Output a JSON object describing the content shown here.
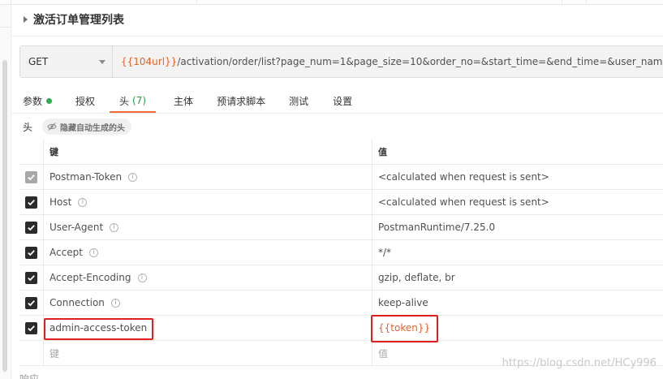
{
  "request": {
    "title": "激活订单管理列表"
  },
  "url_bar": {
    "method": "GET",
    "url_var": "{{104url}}",
    "url_rest": "/activation/order/list?page_num=1&page_size=10&order_no=&start_time=&end_time=&user_name=&order_st"
  },
  "tabs": [
    {
      "label": "参数"
    },
    {
      "label": "授权"
    },
    {
      "label": "头",
      "count": "(7)"
    },
    {
      "label": "主体"
    },
    {
      "label": "预请求脚本"
    },
    {
      "label": "测试"
    },
    {
      "label": "设置"
    }
  ],
  "headers_section": {
    "label": "头",
    "hide_button": "隐藏自动生成的头"
  },
  "table": {
    "col_key": "键",
    "col_value": "值",
    "rows": [
      {
        "key": "Postman-Token",
        "value": "<calculated when request is sent>"
      },
      {
        "key": "Host",
        "value": "<calculated when request is sent>"
      },
      {
        "key": "User-Agent",
        "value": "PostmanRuntime/7.25.0"
      },
      {
        "key": "Accept",
        "value": "*/*"
      },
      {
        "key": "Accept-Encoding",
        "value": "gzip, deflate, br"
      },
      {
        "key": "Connection",
        "value": "keep-alive"
      },
      {
        "key": "admin-access-token",
        "value": "{{token}}"
      }
    ],
    "new_key_placeholder": "键",
    "new_value_placeholder": "值"
  },
  "response_label": "响应",
  "watermark": "https://blog.csdn.net/HCy996",
  "colors": {
    "accent": "#f26b3a",
    "variable": "#e2632a",
    "highlight": "#e0201f",
    "active_dot": "#2fa84f"
  }
}
